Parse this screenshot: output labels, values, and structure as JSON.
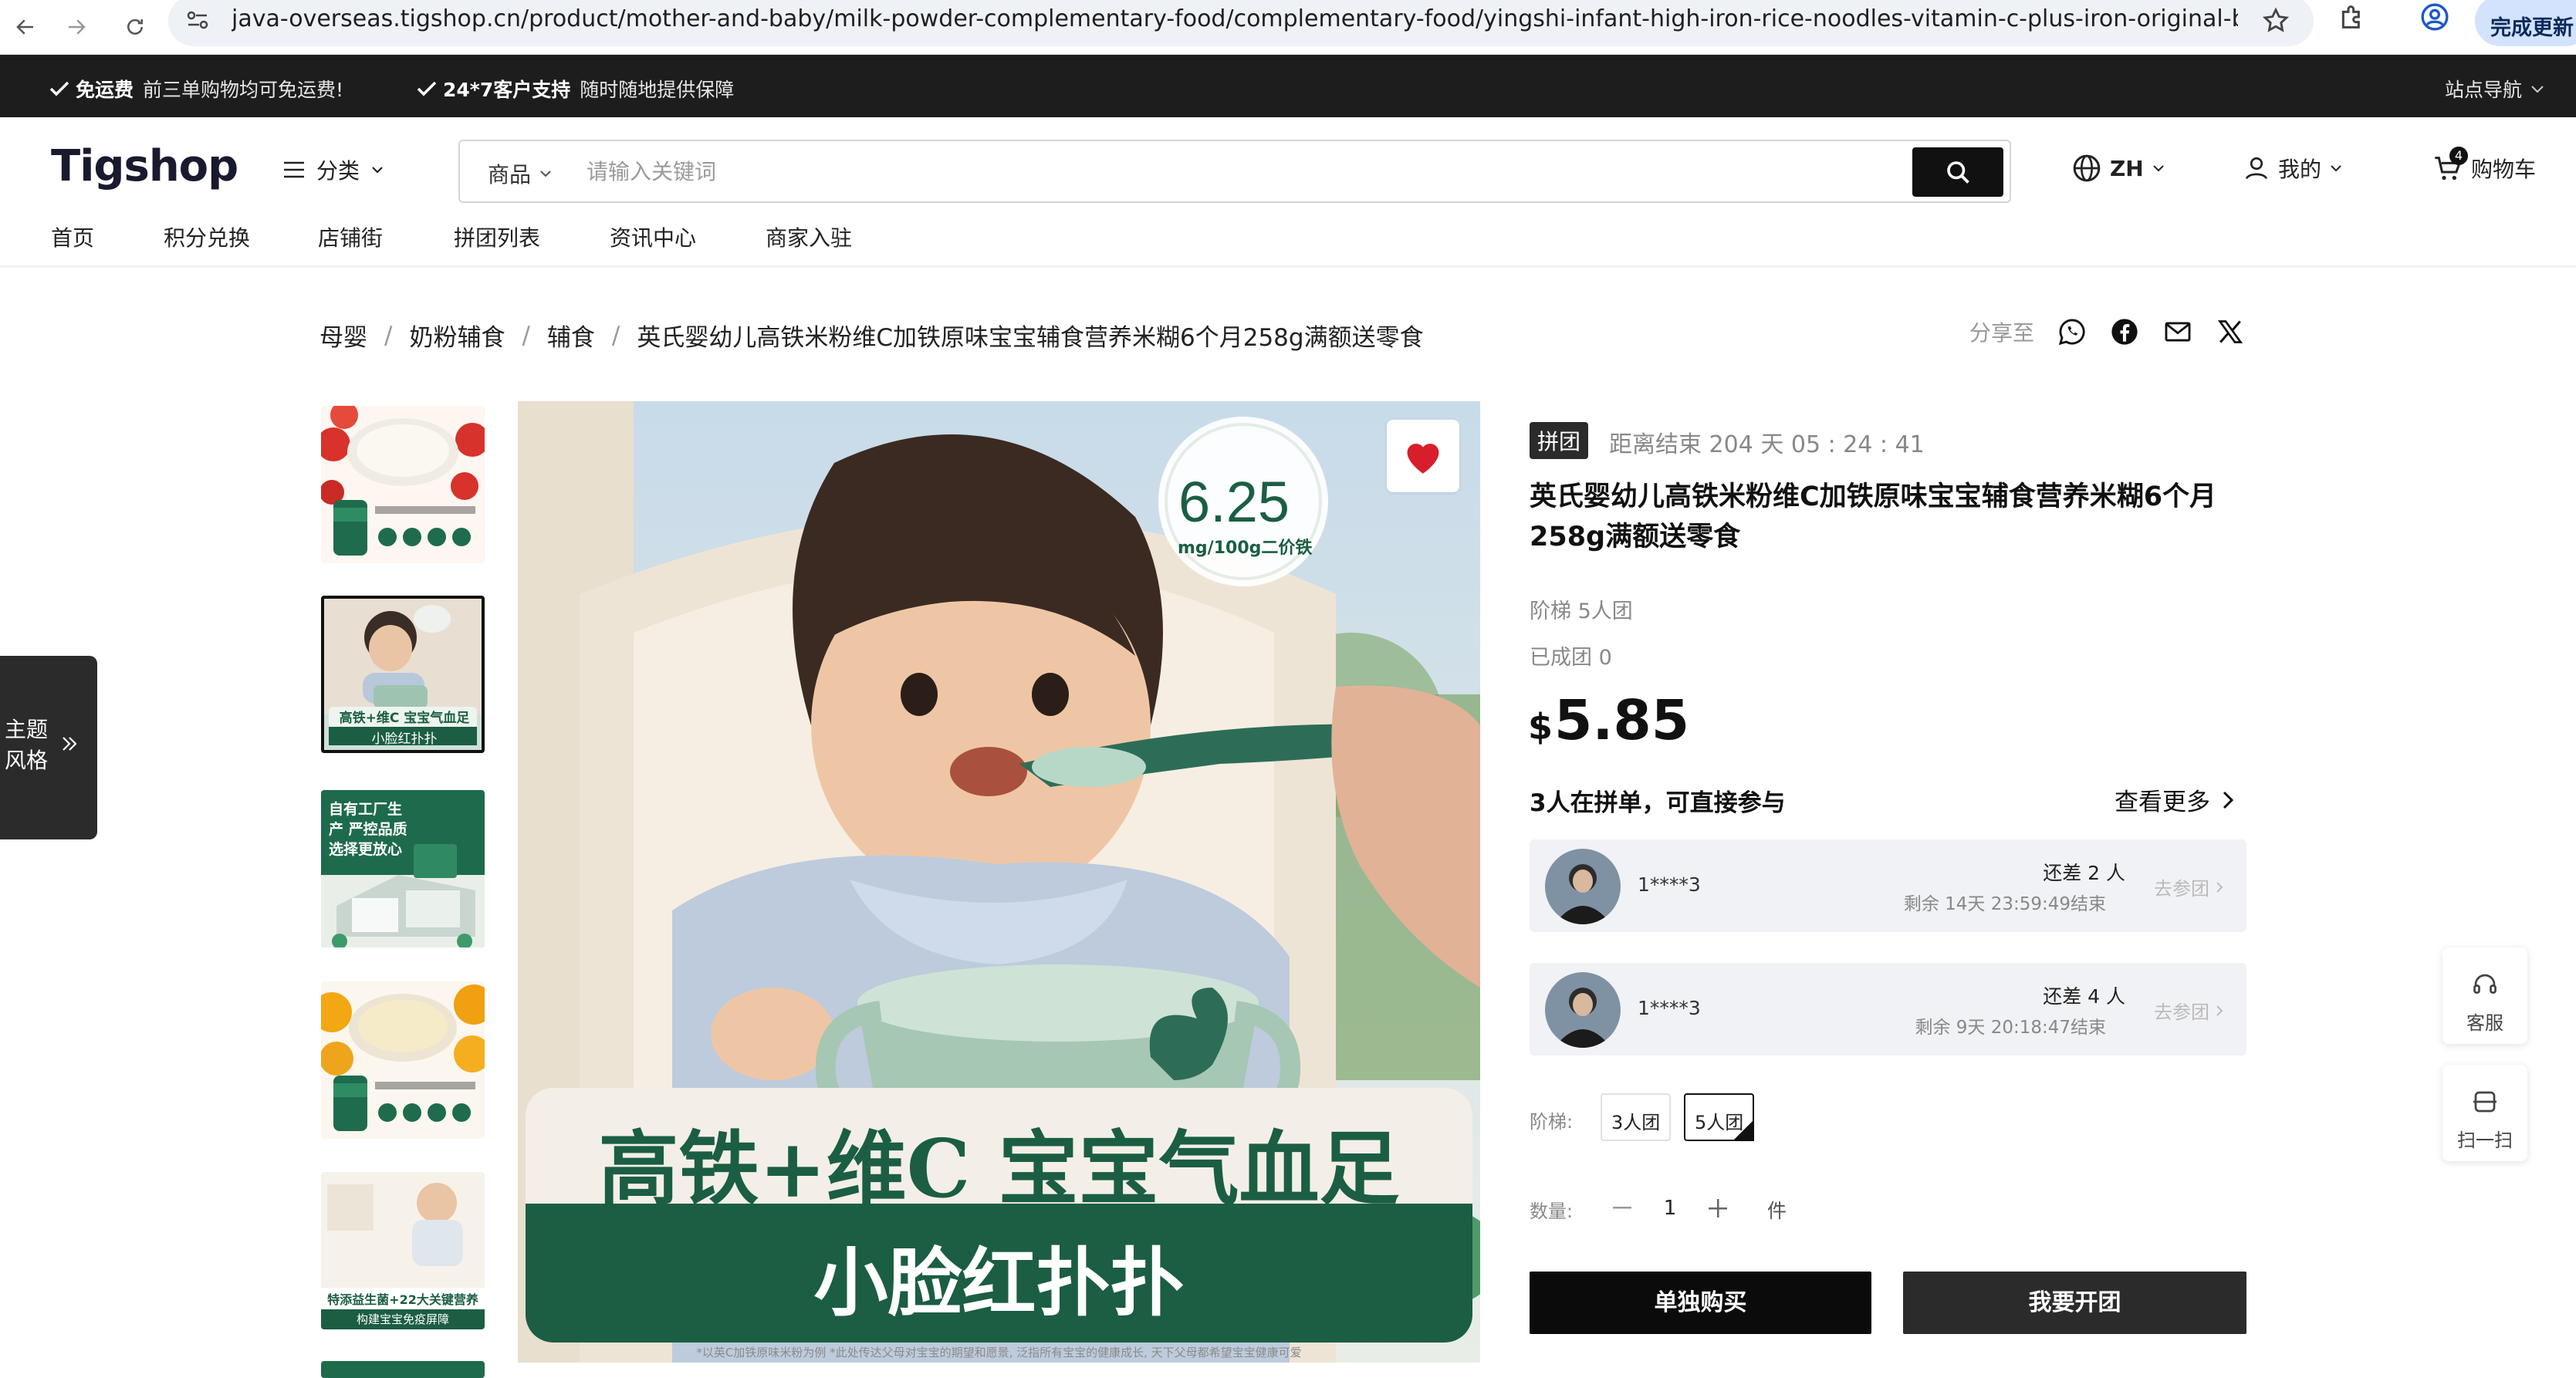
{
  "browser": {
    "url": "java-overseas.tigshop.cn/product/mother-and-baby/milk-powder-complementary-food/complementary-food/yingshi-infant-high-iron-rice-noodles-vitamin-c-plus-iron-original-baby-complement...",
    "update_label": "完成更新"
  },
  "topbar": {
    "free_ship_bold": "免运费",
    "free_ship_text": "前三单购物均可免运费!",
    "service_bold": "24*7客户支持",
    "service_text": "随时随地提供保障",
    "site_nav": "站点导航"
  },
  "header": {
    "logo": "igshop",
    "logo_initial": "T",
    "category": "分类",
    "search_scope": "商品",
    "search_placeholder": "请输入关键词",
    "language": "ZH",
    "account": "我的",
    "cart": "购物车",
    "cart_count": "4"
  },
  "nav": [
    "首页",
    "积分兑换",
    "店铺街",
    "拼团列表",
    "资讯中心",
    "商家入驻"
  ],
  "breadcrumb": [
    "母婴",
    "奶粉辅食",
    "辅食",
    "英氏婴幼儿高铁米粉维C加铁原味宝宝辅食营养米糊6个月258g满额送零食"
  ],
  "share": {
    "label": "分享至"
  },
  "theme_tab": {
    "line1": "主题",
    "line2": "风格"
  },
  "gallery": {
    "badge_value": "6.25",
    "badge_unit": "mg/100g二价铁",
    "headline": "高铁+维C 宝宝气血足",
    "subline": "小脸红扑扑",
    "footnote": "*以英C加铁原味米粉为例 *此处传达父母对宝宝的期望和愿景, 泛指所有宝宝的健康成长, 天下父母都希望宝宝健康可爱",
    "thumb2_text": "高铁+维C 宝宝气血足",
    "thumb2_sub": "小脸红扑扑",
    "thumb3_text": "自有工厂生产 严控品质 选择更放心",
    "thumb5_text": "特添益生菌+22大关键营养",
    "thumb5_sub": "构建宝宝免疫屏障"
  },
  "product": {
    "badge": "拼团",
    "countdown": "距离结束 204 天 05 : 24 : 41",
    "title": "英氏婴幼儿高铁米粉维C加铁原味宝宝辅食营养米糊6个月258g满额送零食",
    "tier_info": "阶梯 5人团",
    "formed": "已成团 0",
    "currency": "$",
    "price": "5.85",
    "groups_heading": "3人在拼单，可直接参与",
    "see_more": "查看更多"
  },
  "groups": [
    {
      "name": "1****3",
      "need": "还差 2 人",
      "remaining": "剩余 14天 23:59:49结束",
      "join": "去参团"
    },
    {
      "name": "1****3",
      "need": "还差 4 人",
      "remaining": "剩余 9天 20:18:47结束",
      "join": "去参团"
    }
  ],
  "options": {
    "tier_label": "阶梯:",
    "tiers": [
      "3人团",
      "5人团"
    ],
    "selected_tier": "5人团",
    "qty_label": "数量:",
    "qty": "1",
    "unit": "件"
  },
  "actions": {
    "buy_alone": "单独购买",
    "start_group": "我要开团"
  },
  "floating": {
    "service": "客服",
    "scan": "扫一扫"
  }
}
